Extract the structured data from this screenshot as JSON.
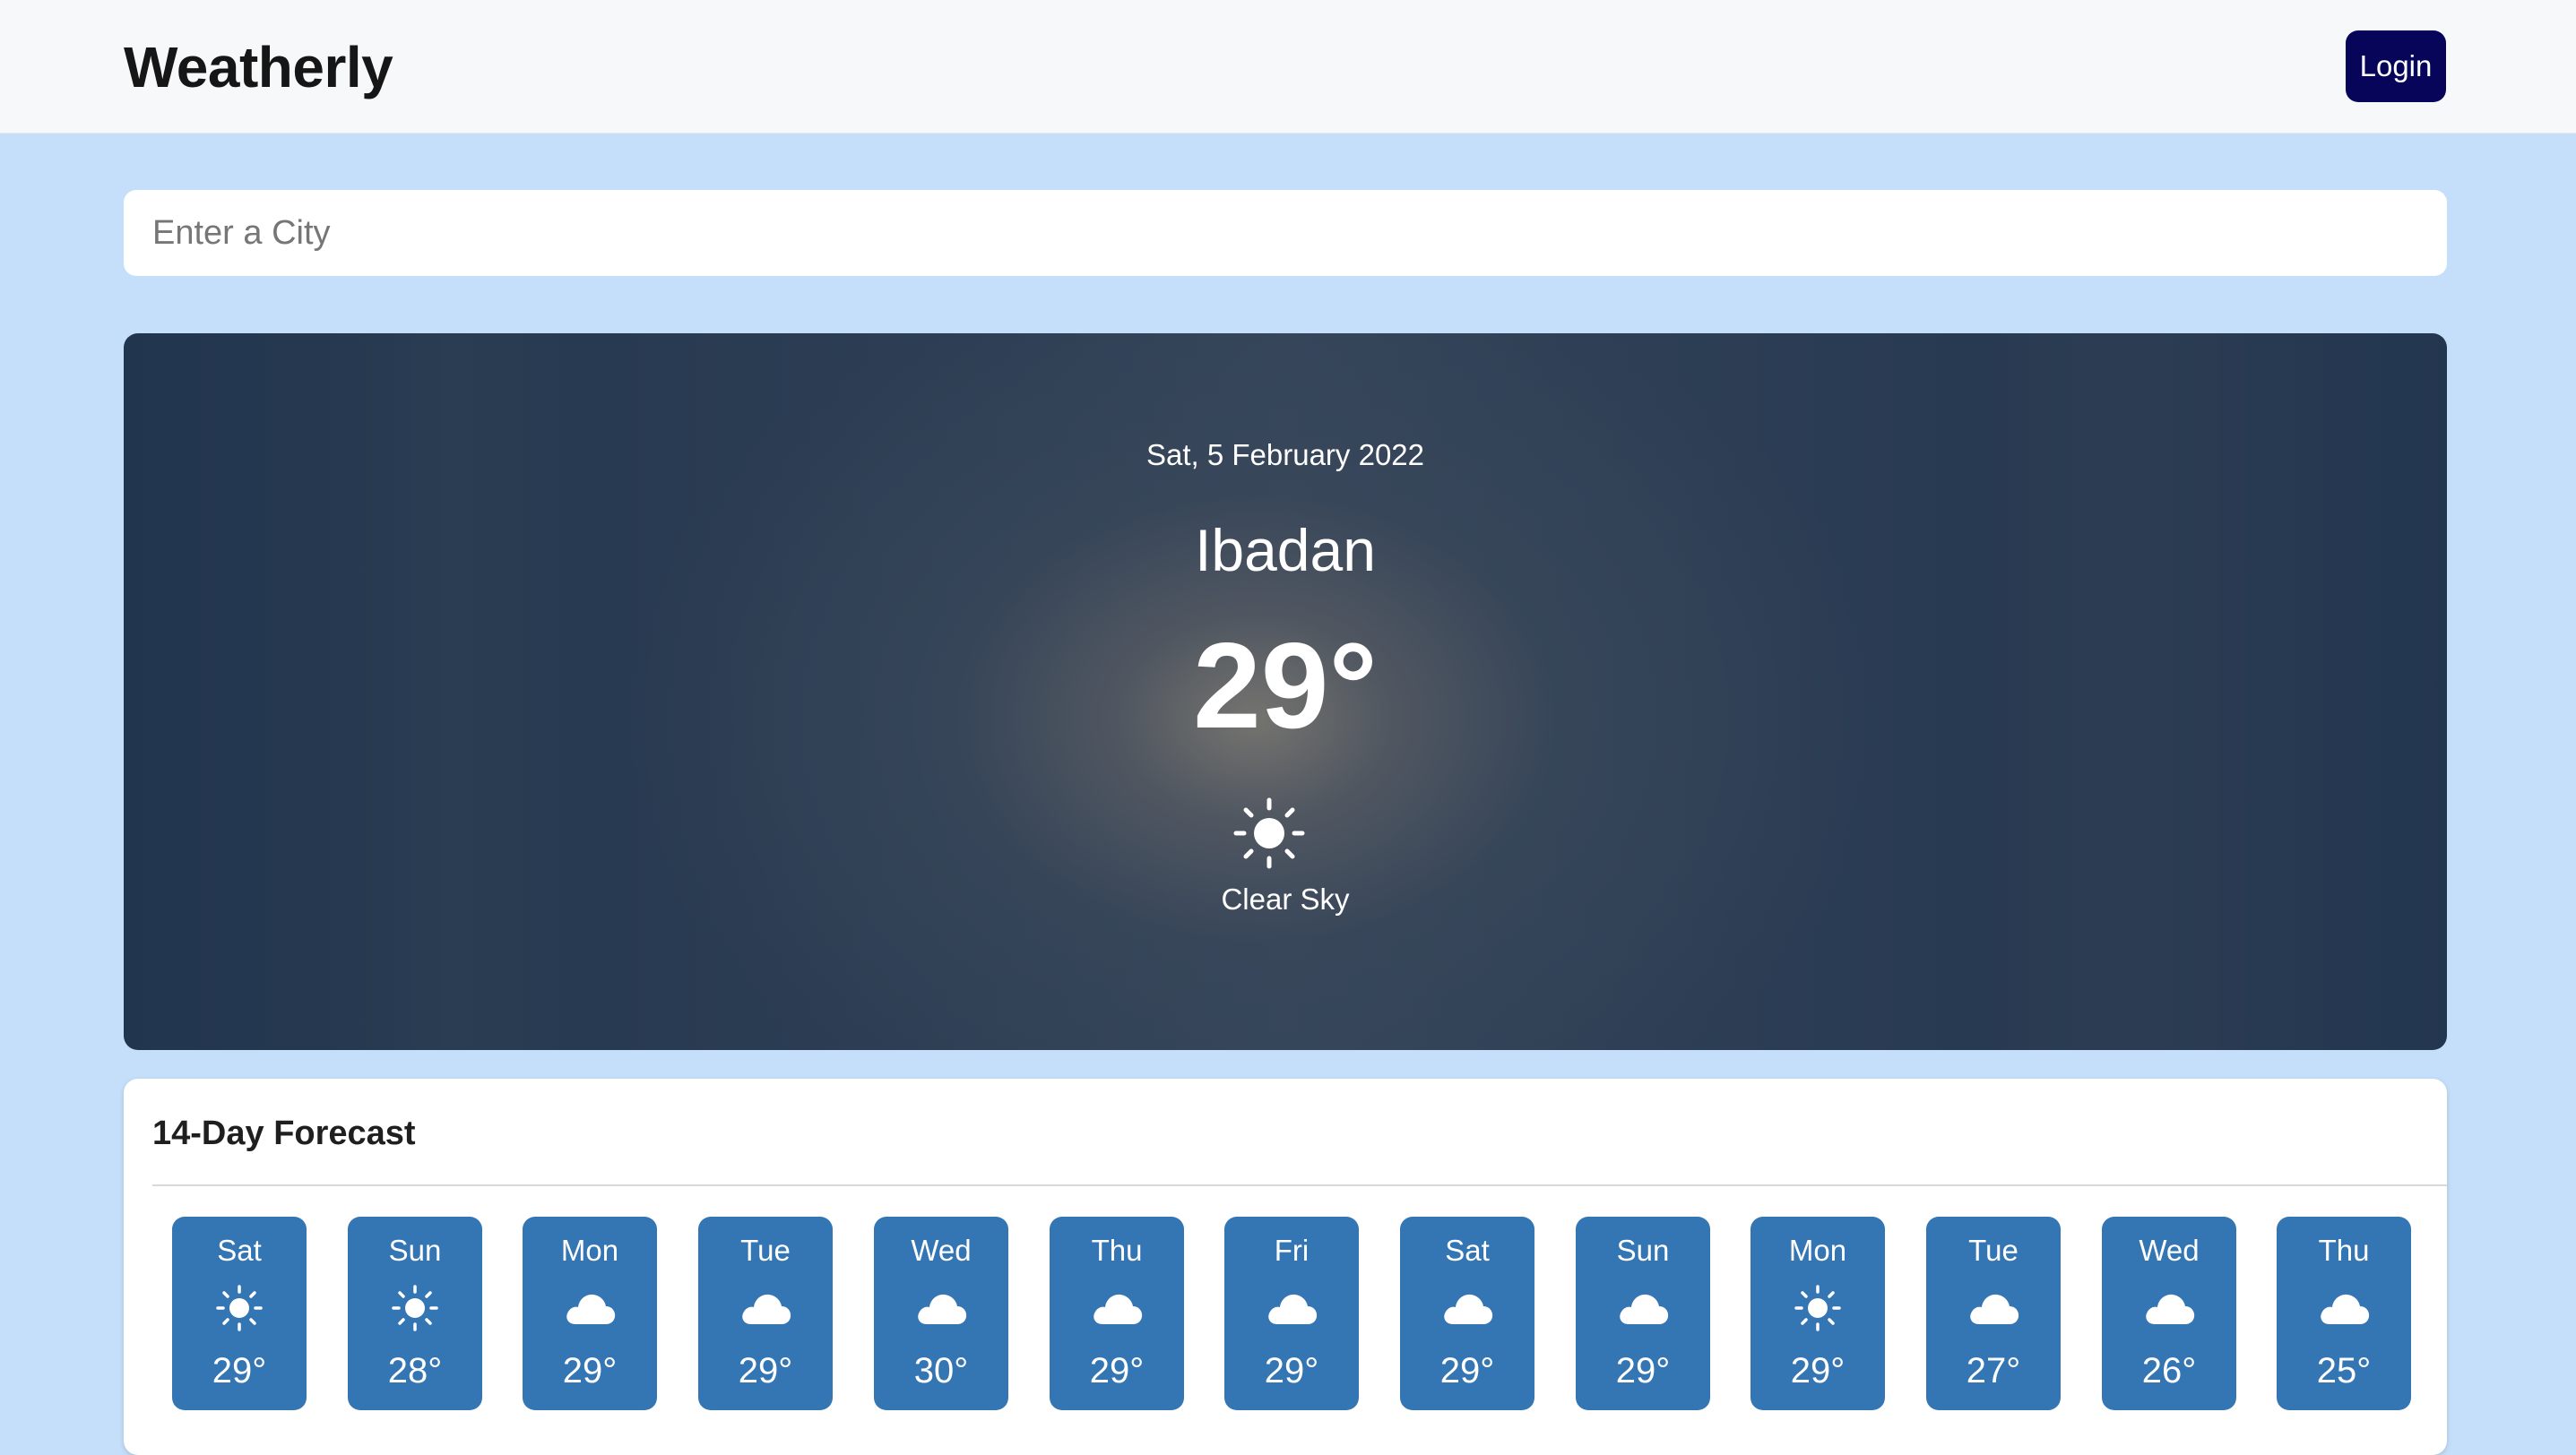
{
  "header": {
    "brand": "Weatherly",
    "login_label": "Login"
  },
  "search": {
    "placeholder": "Enter a City",
    "value": ""
  },
  "current": {
    "date": "Sat, 5 February 2022",
    "city": "Ibadan",
    "temperature": "29°",
    "condition": "Clear Sky",
    "icon": "sun-icon"
  },
  "forecast": {
    "title": "14-Day Forecast",
    "days": [
      {
        "day": "Sat",
        "temp": "29°",
        "icon": "sun-icon"
      },
      {
        "day": "Sun",
        "temp": "28°",
        "icon": "sun-icon"
      },
      {
        "day": "Mon",
        "temp": "29°",
        "icon": "cloud-icon"
      },
      {
        "day": "Tue",
        "temp": "29°",
        "icon": "cloud-icon"
      },
      {
        "day": "Wed",
        "temp": "30°",
        "icon": "cloud-icon"
      },
      {
        "day": "Thu",
        "temp": "29°",
        "icon": "cloud-icon"
      },
      {
        "day": "Fri",
        "temp": "29°",
        "icon": "cloud-icon"
      },
      {
        "day": "Sat",
        "temp": "29°",
        "icon": "cloud-icon"
      },
      {
        "day": "Sun",
        "temp": "29°",
        "icon": "cloud-icon"
      },
      {
        "day": "Mon",
        "temp": "29°",
        "icon": "sun-icon"
      },
      {
        "day": "Tue",
        "temp": "27°",
        "icon": "cloud-icon"
      },
      {
        "day": "Wed",
        "temp": "26°",
        "icon": "cloud-icon"
      },
      {
        "day": "Thu",
        "temp": "25°",
        "icon": "cloud-icon"
      },
      {
        "day": "",
        "temp": "",
        "icon": ""
      }
    ]
  },
  "colors": {
    "page_background": "#c5dffa",
    "navbar_background": "#f7f8fa",
    "login_button": "#07055a",
    "hero_background": "#2b3d53",
    "forecast_tile": "#3475b4"
  }
}
